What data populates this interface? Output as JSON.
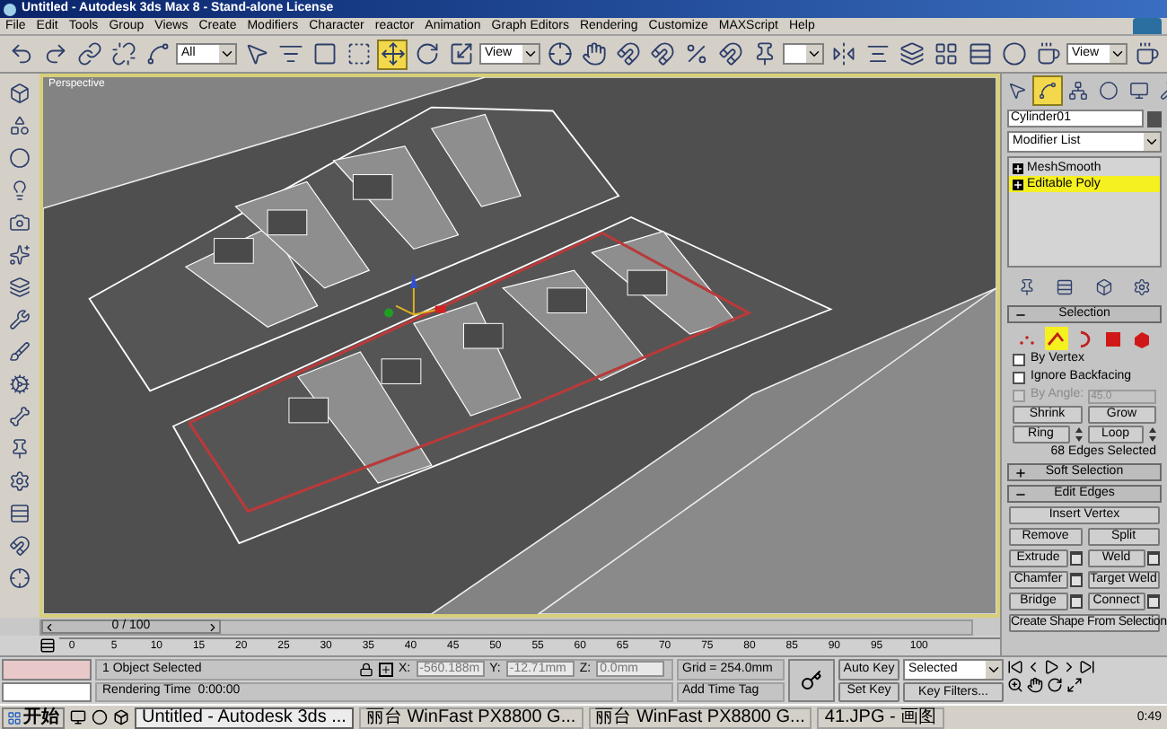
{
  "window": {
    "title": "Untitled - Autodesk 3ds Max 8 - Stand-alone License"
  },
  "menu": [
    "File",
    "Edit",
    "Tools",
    "Group",
    "Views",
    "Create",
    "Modifiers",
    "Character",
    "reactor",
    "Animation",
    "Graph Editors",
    "Rendering",
    "Customize",
    "MAXScript",
    "Help"
  ],
  "toolbar": {
    "selection_filter": "All",
    "reference_coord": "View",
    "render_view": "View",
    "transform_tools": [
      {
        "kind": "move",
        "selected": true
      },
      {
        "kind": "rotate",
        "selected": false
      },
      {
        "kind": "scale",
        "selected": false
      }
    ]
  },
  "viewport": {
    "label": "Perspective"
  },
  "command_panel": {
    "tabs": [
      {
        "kind": "create",
        "selected": false
      },
      {
        "kind": "modify",
        "selected": true
      },
      {
        "kind": "hierarchy",
        "selected": false
      },
      {
        "kind": "motion",
        "selected": false
      },
      {
        "kind": "display",
        "selected": false
      },
      {
        "kind": "utilities",
        "selected": false
      }
    ],
    "object_name": "Cylinder01",
    "modifier_list": "Modifier List",
    "stack": [
      {
        "label": "MeshSmooth",
        "selected": false
      },
      {
        "label": "Editable Poly",
        "selected": true
      }
    ],
    "selection": {
      "title": "Selection",
      "expanded": true,
      "subobjects": [
        {
          "kind": "vertex",
          "selected": false
        },
        {
          "kind": "edge",
          "selected": true
        },
        {
          "kind": "border",
          "selected": false
        },
        {
          "kind": "polygon",
          "selected": false
        },
        {
          "kind": "element",
          "selected": false
        }
      ],
      "options": [
        {
          "label": "By Vertex",
          "checked": false,
          "disabled": false
        },
        {
          "label": "Ignore Backfacing",
          "checked": false,
          "disabled": false
        },
        {
          "label": "By Angle:",
          "checked": false,
          "disabled": true
        }
      ],
      "angle": "45.0",
      "shrink": "Shrink",
      "grow": "Grow",
      "ring": "Ring",
      "loop": "Loop",
      "status": "68 Edges Selected"
    },
    "soft_selection": {
      "title": "Soft Selection",
      "expanded": false
    },
    "edit_edges": {
      "title": "Edit Edges",
      "expanded": true,
      "insert_vertex": "Insert Vertex",
      "buttons": [
        {
          "label": "Remove",
          "settings": false
        },
        {
          "label": "Split",
          "settings": false
        },
        {
          "label": "Extrude",
          "settings": true
        },
        {
          "label": "Weld",
          "settings": true
        },
        {
          "label": "Chamfer",
          "settings": true
        },
        {
          "label": "Target Weld",
          "settings": false
        },
        {
          "label": "Bridge",
          "settings": true
        },
        {
          "label": "Connect",
          "settings": true
        }
      ],
      "create_shape": "Create Shape From Selection"
    }
  },
  "timeline": {
    "frame": "0 / 100",
    "level": 0,
    "ticks": [
      "0",
      "5",
      "10",
      "15",
      "20",
      "25",
      "30",
      "35",
      "40",
      "45",
      "50",
      "55",
      "60",
      "65",
      "70",
      "75",
      "80",
      "85",
      "90",
      "95",
      "100"
    ]
  },
  "status_bar": {
    "selected": "1 Object Selected",
    "prompt": "Rendering Time  0:00:00",
    "coordinates": [
      {
        "axis": "X:",
        "value": "-560.188m"
      },
      {
        "axis": "Y:",
        "value": "-12.71mm"
      },
      {
        "axis": "Z:",
        "value": "0.0mm"
      }
    ],
    "grid": "Grid = 254.0mm",
    "time_tag": "Add Time Tag",
    "auto_key": "Auto Key",
    "set_key": "Set Key",
    "key_mode": "Selected",
    "key_filters": "Key Filters..."
  },
  "taskbar": {
    "start": "开始",
    "tasks": [
      {
        "label": "Untitled - Autodesk 3ds ...",
        "selected": true
      },
      {
        "label": "丽台 WinFast PX8800 G...",
        "selected": false
      },
      {
        "label": "丽台 WinFast PX8800 G...",
        "selected": false
      },
      {
        "label": "41.JPG - 画图",
        "selected": false
      }
    ],
    "clock": "0:49"
  }
}
